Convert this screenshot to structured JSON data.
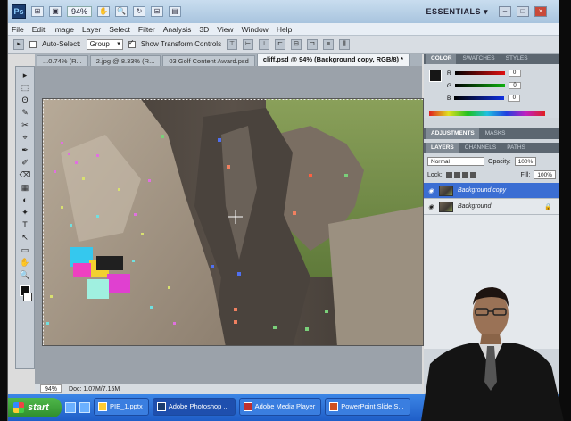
{
  "appbar": {
    "logo": "Ps",
    "zoom": "94%",
    "workspace": "ESSENTIALS ▾",
    "buttons": [
      "⊞",
      "▣",
      "✋",
      "🔍",
      "↻",
      "⊟",
      "▤"
    ]
  },
  "menu": [
    "File",
    "Edit",
    "Image",
    "Layer",
    "Select",
    "Filter",
    "Analysis",
    "3D",
    "View",
    "Window",
    "Help"
  ],
  "options": {
    "auto_select_label": "Auto-Select:",
    "auto_select_value": "Group",
    "show_transform_label": "Show Transform Controls"
  },
  "tabs": [
    {
      "label": "...0.74% (R..."
    },
    {
      "label": "2.jpg @ 8.33% (R..."
    },
    {
      "label": "03 Golf Content Award.psd"
    },
    {
      "label": "cliff.psd @ 94% (Background copy, RGB/8) *",
      "active": true
    }
  ],
  "tools": [
    "▸",
    "⬚",
    "ʘ",
    "✎",
    "✂",
    "⌖",
    "✒",
    "✐",
    "⌫",
    "▦",
    "◐",
    "✦",
    "T",
    "↖",
    "▭",
    "✋",
    "🔍"
  ],
  "status": {
    "zoom": "94%",
    "doc": "Doc: 1.07M/7.15M"
  },
  "color_panel": {
    "tabs": [
      "COLOR",
      "SWATCHES",
      "STYLES"
    ],
    "channels": [
      {
        "label": "R",
        "value": "0",
        "color": "#c81e1e"
      },
      {
        "label": "G",
        "value": "0",
        "color": "#1ea01e"
      },
      {
        "label": "B",
        "value": "0",
        "color": "#1e3cc8"
      }
    ]
  },
  "adjustments_tabs": [
    "ADJUSTMENTS",
    "MASKS"
  ],
  "layers_panel": {
    "tabs": [
      "LAYERS",
      "CHANNELS",
      "PATHS"
    ],
    "blend_mode": "Normal",
    "opacity_label": "Opacity:",
    "opacity": "100%",
    "lock_label": "Lock:",
    "fill_label": "Fill:",
    "fill": "100%",
    "layers": [
      {
        "name": "Background copy",
        "selected": true
      },
      {
        "name": "Background",
        "locked": true
      }
    ]
  },
  "taskbar": {
    "start": "start",
    "items": [
      {
        "label": "PIE_1.pptx"
      },
      {
        "label": "Adobe Photoshop ...",
        "active": true
      },
      {
        "label": "Adobe Media Player"
      },
      {
        "label": "PowerPoint Slide S..."
      }
    ]
  },
  "accent_colors": {
    "selection": "#3b6ed3",
    "taskbar": "#1f5ec8",
    "start": "#2f8d2c"
  }
}
